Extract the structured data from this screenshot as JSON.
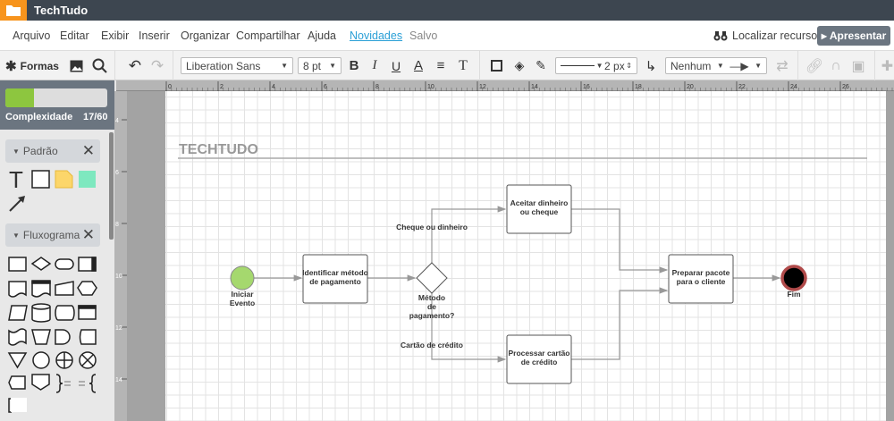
{
  "app": {
    "title": "TechTudo",
    "folder_icon": "folder-icon"
  },
  "menu": {
    "items": [
      "Arquivo",
      "Editar",
      "Exibir",
      "Inserir",
      "Organizar",
      "Compartilhar",
      "Ajuda"
    ],
    "news": "Novidades",
    "status": "Salvo",
    "locate": "Localizar recurso",
    "present": "Apresentar"
  },
  "toolbar": {
    "shapes": "Formas",
    "font": "Liberation Sans",
    "font_size": "8 pt",
    "line_width": "2 px",
    "line_start": "Nenhum"
  },
  "sidebar": {
    "complexity_label": "Complexidade",
    "complexity_value": "17/60",
    "complexity_fraction": 0.283,
    "sections": [
      {
        "title": "Padrão"
      },
      {
        "title": "Fluxograma"
      }
    ]
  },
  "ruler": {
    "h": [
      "0",
      "2",
      "4",
      "6",
      "8",
      "10",
      "12",
      "14",
      "16",
      "18",
      "20",
      "22",
      "24",
      "26"
    ],
    "v": [
      "4",
      "6",
      "8",
      "10",
      "12",
      "14"
    ]
  },
  "diagram": {
    "heading": "TECHTUDO",
    "start": [
      "Iniciar",
      "Evento"
    ],
    "identify": [
      "Identificar método",
      "de pagamento"
    ],
    "decision": [
      "Método",
      "de",
      "pagamento?"
    ],
    "branch_top": "Cheque ou dinheiro",
    "branch_bottom": "Cartão de crédito",
    "accept": [
      "Aceitar dinheiro",
      "ou cheque"
    ],
    "process": [
      "Processar cartão",
      "de crédito"
    ],
    "prepare": [
      "Preparar pacote",
      "para o cliente"
    ],
    "end": "Fim",
    "colors": {
      "start": "#a5d86e",
      "end_ring": "#b04a4a",
      "end_fill": "#000000"
    }
  }
}
